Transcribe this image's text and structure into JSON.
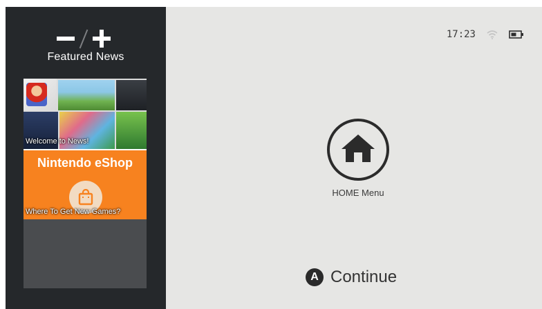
{
  "sidebar": {
    "title": "Featured News",
    "tiles": [
      {
        "caption": "Welcome to News!"
      },
      {
        "logo": "Nintendo eShop",
        "caption": "Where To Get New Games?"
      }
    ]
  },
  "status": {
    "time": "17:23",
    "wifi_icon": "wifi-icon",
    "battery_icon": "battery-icon"
  },
  "home": {
    "label": "HOME Menu",
    "icon": "home-icon"
  },
  "continue": {
    "button": "A",
    "label": "Continue"
  },
  "colors": {
    "sidebar_bg": "#25282b",
    "main_bg": "#e6e6e4",
    "eshop_orange": "#f7821f",
    "text_dark": "#333333"
  }
}
